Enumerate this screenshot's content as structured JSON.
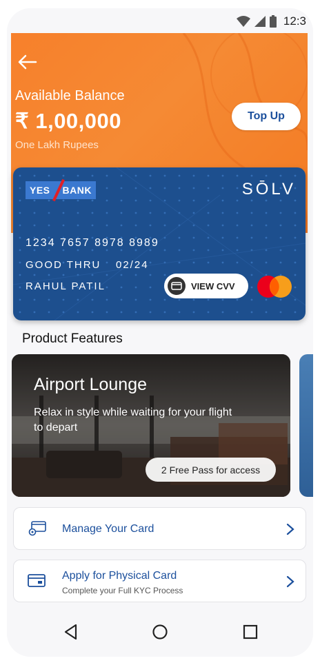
{
  "status_bar": {
    "time": "12:3",
    "icons": [
      "wifi-icon",
      "signal-icon",
      "battery-icon"
    ]
  },
  "header": {
    "back_icon": "arrow-left-icon",
    "available_label": "Available Balance",
    "balance": "₹ 1,00,000",
    "balance_words": "One Lakh Rupees",
    "topup_label": "Top Up"
  },
  "card": {
    "bank_left": "YES",
    "bank_right": "BANK",
    "brand": "SŌLV",
    "number": "1234 7657 8978 8989",
    "good_thru_label": "GOOD THRU",
    "expiry": "02/24",
    "holder": "RAHUL PATIL",
    "cvv_label": "VIEW CVV",
    "network_icon": "mastercard-icon"
  },
  "features": {
    "section_title": "Product Features",
    "items": [
      {
        "title": "Airport Lounge",
        "description": "Relax in style while waiting for your flight to depart",
        "badge": "2 Free Pass for access"
      }
    ]
  },
  "menu": [
    {
      "label": "Manage Your Card",
      "subtitle": "",
      "icon": "card-settings-icon"
    },
    {
      "label": "Apply for Physical Card",
      "subtitle": "Complete your Full KYC Process",
      "icon": "card-icon"
    }
  ],
  "nav": [
    "back-triangle-icon",
    "home-circle-icon",
    "recents-square-icon"
  ],
  "colors": {
    "accent_orange": "#f7802b",
    "card_blue": "#1d4f8e",
    "link_blue": "#1b4f9c"
  }
}
